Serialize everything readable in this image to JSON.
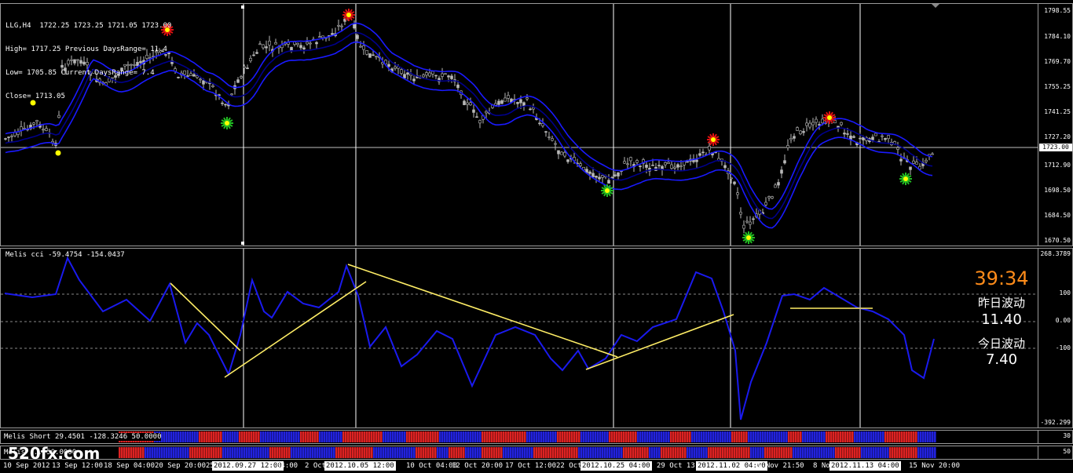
{
  "main_chart": {
    "info_lines": [
      "LLG,H4  1722.25 1723.25 1721.05 1723.00",
      "High= 1717.25 Previous DaysRange= 11.4",
      "Low= 1705.85 Current DaysRange= 7.4",
      "Close= 1713.05"
    ],
    "price_labels": [
      "1798.55",
      "1784.10",
      "1769.70",
      "1755.25",
      "1741.25",
      "1727.20",
      "1712.90",
      "1698.50",
      "1684.50",
      "1670.50"
    ],
    "current_price": "1723.00",
    "colors": {
      "candle": "#b8b8b8",
      "band": "#1a1aff",
      "band_dark": "#00008b",
      "crosshair": "#ffffff"
    },
    "signals": [
      {
        "type": "sell",
        "icon": "red-star-icon"
      },
      {
        "type": "buy",
        "icon": "green-star-icon"
      },
      {
        "type": "point",
        "icon": "yellow-dot-icon"
      }
    ]
  },
  "cci_panel": {
    "label": "Melis cci -59.4754 -154.0437",
    "scale_labels": [
      "268.3789",
      "100",
      "0.00",
      "-100",
      "-392.299"
    ],
    "countdown": "39:34",
    "yesterday_label": "昨日波动",
    "yesterday_value": "11.40",
    "today_label": "今日波动",
    "today_value": "7.40",
    "colors": {
      "line": "#1a1aee",
      "trend": "#ffee66",
      "countdown": "#ff8c1a"
    }
  },
  "hist1": {
    "label": "Melis Short 29.4501 -128.3246 50.0000",
    "scale": "30"
  },
  "hist2": {
    "label": "Melis ... 50.0000",
    "scale": "50"
  },
  "time_axis": {
    "labels": [
      {
        "text": "10 Sep 2012",
        "boxed": false
      },
      {
        "text": "13 Sep 12:00",
        "boxed": false
      },
      {
        "text": "18 Sep 04:00",
        "boxed": false
      },
      {
        "text": "20 Sep 20:00",
        "boxed": false
      },
      {
        "text": "25",
        "boxed": false
      },
      {
        "text": "2012.09.27 12:00",
        "boxed": true
      },
      {
        "text": "04:00",
        "boxed": false
      },
      {
        "text": "2 Oct",
        "boxed": false
      },
      {
        "text": "2012.10.05 12:00",
        "boxed": true
      },
      {
        "text": "10 Oct 04:00",
        "boxed": false
      },
      {
        "text": "12 Oct 20:00",
        "boxed": false
      },
      {
        "text": "17 Oct 12:00",
        "boxed": false
      },
      {
        "text": "22 Oct",
        "boxed": false
      },
      {
        "text": "2012.10.25 04:00",
        "boxed": true
      },
      {
        "text": "29 Oct 13:5",
        "boxed": false
      },
      {
        "text": "2012.11.02 04:00",
        "boxed": true
      },
      {
        "text": "5 Nov 21:50",
        "boxed": false
      },
      {
        "text": "8 Nov",
        "boxed": false
      },
      {
        "text": "2012.11.13 04:00",
        "boxed": true
      },
      {
        "text": "15 Nov 20:00",
        "boxed": false
      }
    ]
  },
  "watermark": "520fx.com"
}
